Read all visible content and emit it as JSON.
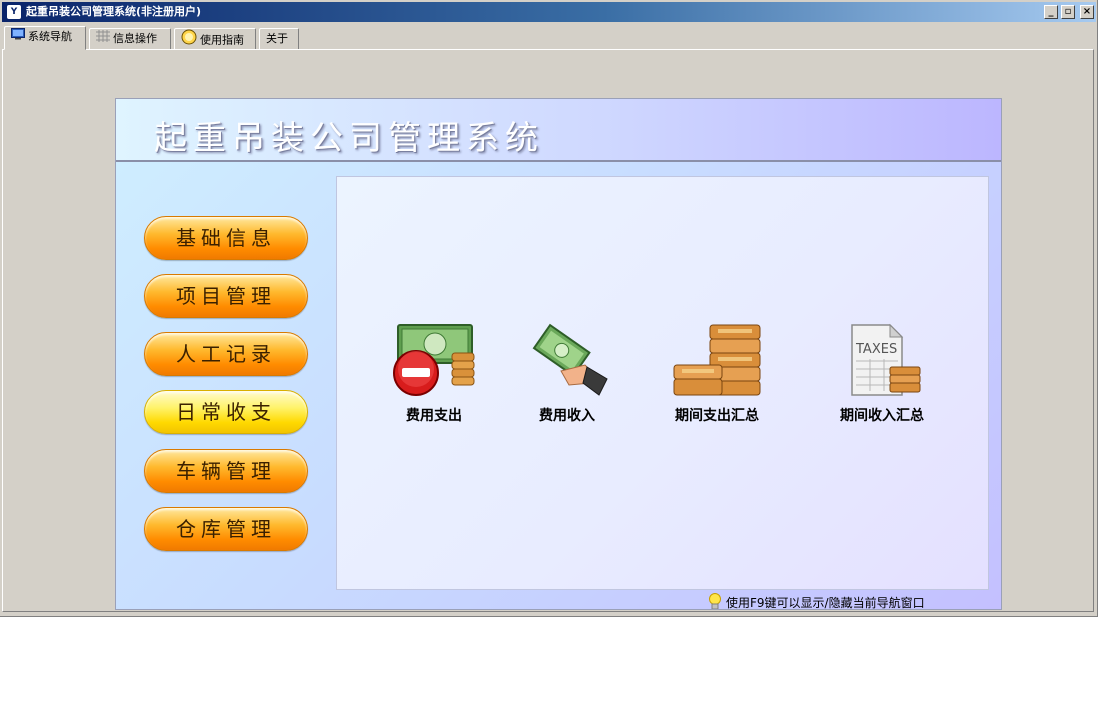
{
  "window": {
    "title": "起重吊装公司管理系统(非注册用户)",
    "app_icon": "Y",
    "minimize_glyph": "_",
    "restore_glyph": "▫",
    "close_glyph": "×"
  },
  "tabs": [
    {
      "label": "系统导航",
      "icon": "monitor-icon",
      "active": true
    },
    {
      "label": "信息操作",
      "icon": "grid-icon",
      "active": false
    },
    {
      "label": "使用指南",
      "icon": "guide-icon",
      "active": false
    },
    {
      "label": "关于",
      "icon": "",
      "active": false
    }
  ],
  "panel": {
    "title": "起重吊装公司管理系统"
  },
  "nav": [
    {
      "label": "基础信息",
      "active": false
    },
    {
      "label": "项目管理",
      "active": false
    },
    {
      "label": "人工记录",
      "active": false
    },
    {
      "label": "日常收支",
      "active": true
    },
    {
      "label": "车辆管理",
      "active": false
    },
    {
      "label": "仓库管理",
      "active": false
    }
  ],
  "features": [
    {
      "label": "费用支出",
      "icon": "money-minus-icon"
    },
    {
      "label": "费用收入",
      "icon": "money-hand-icon"
    },
    {
      "label": "期间支出汇总",
      "icon": "coin-stacks-icon"
    },
    {
      "label": "期间收入汇总",
      "icon": "taxes-document-icon"
    }
  ],
  "taxes_text": "TAXES",
  "hint": {
    "text": "使用F9键可以显示/隐藏当前导航窗口",
    "icon": "lightbulb-icon"
  },
  "colors": {
    "nav_orange": "#ff8c00",
    "nav_active_yellow": "#ffd900",
    "titlebar_start": "#0a246a"
  }
}
